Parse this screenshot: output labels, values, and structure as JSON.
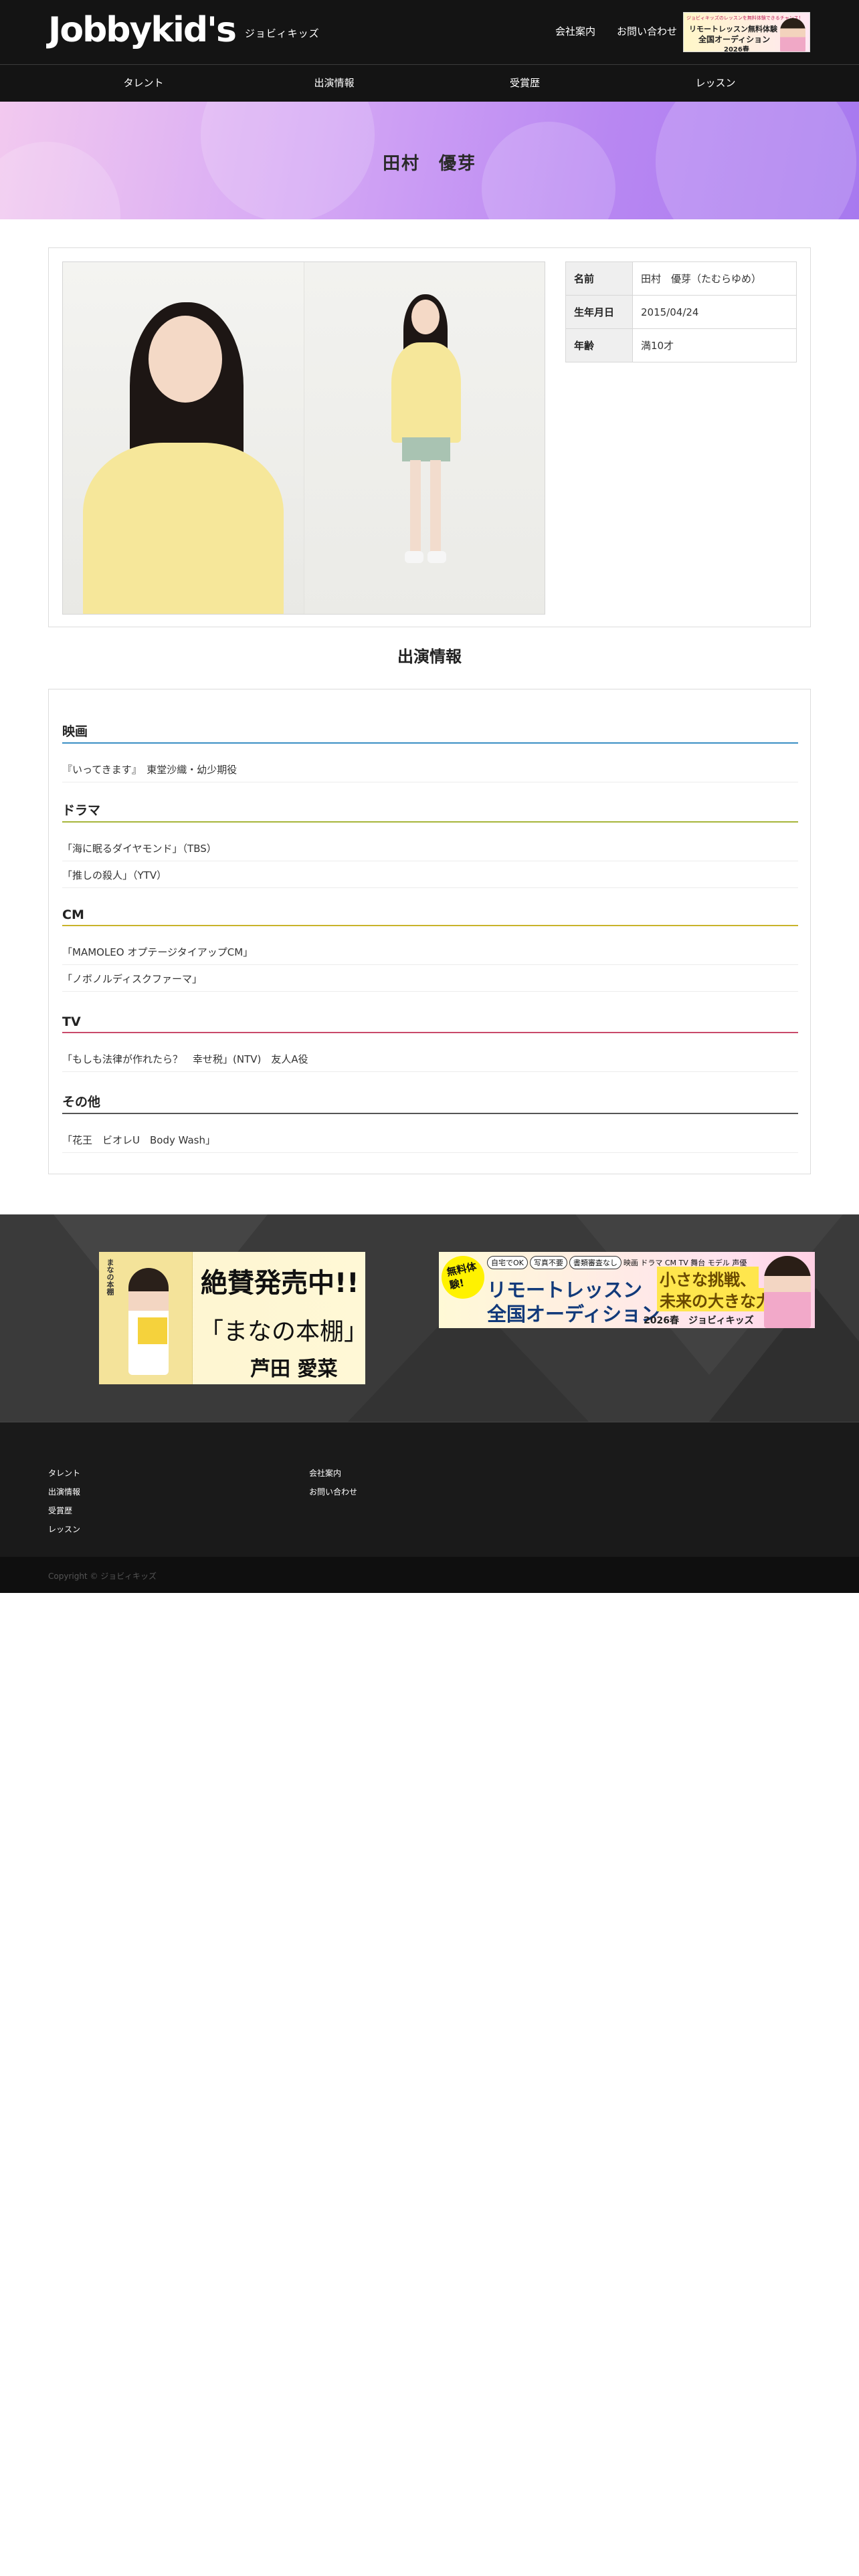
{
  "header": {
    "logo_main": "Jobbykid's",
    "logo_sub": "ジョビィキッズ",
    "links": [
      "会社案内",
      "お問い合わせ"
    ],
    "banner": {
      "top_text": "ジョビィキッズのレッスンを無料体験できるチャンス！",
      "line1": "リモートレッスン無料体験",
      "line2": "全国オーディション",
      "line3": "2026春"
    }
  },
  "nav": {
    "items": [
      "タレント",
      "出演情報",
      "受賞歴",
      "レッスン"
    ]
  },
  "hero": {
    "title": "田村　優芽"
  },
  "profile": {
    "rows": [
      {
        "label": "名前",
        "value": "田村　優芽（たむらゆめ）"
      },
      {
        "label": "生年月日",
        "value": "2015/04/24"
      },
      {
        "label": "年齢",
        "value": "満10才"
      }
    ]
  },
  "appearances": {
    "title": "出演情報",
    "categories": [
      {
        "name": "映画",
        "color": "#3a8fc4",
        "items": [
          "『いってきます』　東堂沙織・幼少期役"
        ]
      },
      {
        "name": "ドラマ",
        "color": "#a6b63a",
        "items": [
          "「海に眠るダイヤモンド」（TBS）",
          "「推しの殺人」（YTV）"
        ]
      },
      {
        "name": "CM",
        "color": "#c9b42a",
        "items": [
          "「MAMOLEO オプテージタイアップCM」",
          "「ノボノルディスクファーマ」"
        ]
      },
      {
        "name": "TV",
        "color": "#c94a6a",
        "items": [
          "「もしも法律が作れたら？　幸せ税」(NTV)　友人A役"
        ]
      },
      {
        "name": "その他",
        "color": "#555555",
        "items": [
          "「花王　ビオレU　Body Wash」"
        ]
      }
    ]
  },
  "banners": {
    "book": {
      "cover_title": "まなの本棚",
      "line1": "絶賛発売中!!",
      "line2": "「まなの本棚」",
      "line3": "芦田 愛菜"
    },
    "lesson": {
      "free": "無料体験!",
      "tags": [
        "自宅でOK",
        "写真不要",
        "書類審査なし"
      ],
      "genres": "映画 ドラマ CM TV 舞台 モデル 声優",
      "main1": "リモートレッスン",
      "main2": "全国オーディション",
      "right1": "小さな挑戦、",
      "right2": "未来の大きな力",
      "right3": "2026春　ジョビィキッズ"
    }
  },
  "footer": {
    "col1": [
      "タレント",
      "出演情報",
      "受賞歴",
      "レッスン"
    ],
    "col2": [
      "会社案内",
      "お問い合わせ"
    ],
    "copyright": "Copyright © ジョビィキッズ"
  }
}
